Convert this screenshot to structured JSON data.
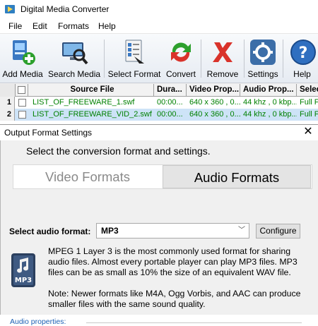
{
  "window": {
    "title": "Digital Media Converter"
  },
  "menu": [
    "File",
    "Edit",
    "Formats",
    "Help"
  ],
  "toolbar": {
    "add_media": "Add Media",
    "search_media": "Search Media",
    "select_format": "Select Format",
    "convert": "Convert",
    "remove": "Remove",
    "settings": "Settings",
    "help": "Help"
  },
  "grid": {
    "columns": [
      "Source File",
      "Dura...",
      "Video Prop...",
      "Audio Prop...",
      "Selec"
    ],
    "rows": [
      {
        "num": "1",
        "source": "LIST_OF_FREEWARE_1.swf",
        "duration": "00:00...",
        "video": "640 x 360 , 0...",
        "audio": "44 khz , 0 kbp...",
        "select": "Full F"
      },
      {
        "num": "2",
        "source": "LIST_OF_FREEWARE_VID_2.swf",
        "duration": "00:00...",
        "video": "640 x 360 , 0...",
        "audio": "44 khz , 0 kbp...",
        "select": "Full F"
      }
    ]
  },
  "dialog": {
    "title": "Output Format Settings",
    "heading": "Select the conversion format and settings.",
    "tabs": {
      "video": "Video Formats",
      "audio": "Audio Formats"
    },
    "select_label": "Select audio format:",
    "select_value": "MP3",
    "configure": "Configure",
    "icon_label": "MP3",
    "description": "MPEG 1 Layer 3 is the most commonly used format for sharing audio files. Almost every portable player can play MP3 files.  MP3 files can be as small as 10% the size of an equivalent WAV file.",
    "note": "Note: Newer formats like M4A, Ogg Vorbis, and AAC can produce smaller files with the same sound quality.",
    "audio_properties": "Audio properties:"
  },
  "colors": {
    "file_text": "#008000",
    "link_blue": "#1a5fb4",
    "active_tab_bg": "#e4e4e4"
  }
}
